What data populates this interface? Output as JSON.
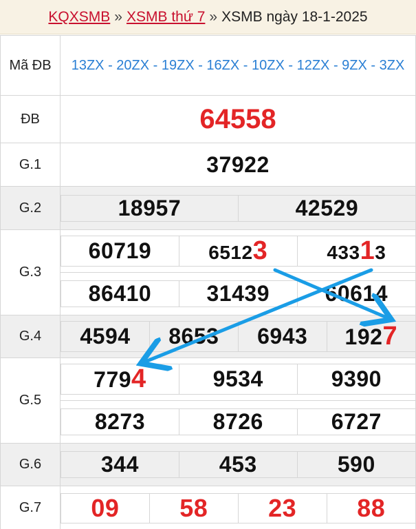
{
  "breadcrumb": {
    "home": "KQXSMB",
    "sep1": "»",
    "section": "XSMB thứ 7",
    "sep2": "»",
    "current": "XSMB ngày 18-1-2025"
  },
  "labels": {
    "ma_db": "Mã ĐB",
    "db": "ĐB",
    "g1": "G.1",
    "g2": "G.2",
    "g3": "G.3",
    "g4": "G.4",
    "g5": "G.5",
    "g6": "G.6",
    "g7": "G.7"
  },
  "codes": "13ZX - 20ZX - 19ZX - 16ZX - 10ZX - 12ZX - 9ZX - 3ZX",
  "db": "64558",
  "g1": "37922",
  "g2": [
    "18957",
    "42529"
  ],
  "g3": {
    "r1c1": "60719",
    "r1c2_prefix": "6512",
    "r1c2_highlight": "3",
    "r1c3_prefix": "433",
    "r1c3_highlight": "1",
    "r1c3_suffix": "3",
    "r2c1": "86410",
    "r2c2": "31439",
    "r2c3": "60614"
  },
  "g4": {
    "c1": "4594",
    "c2": "8653",
    "c3": "6943",
    "c4_prefix": "192",
    "c4_highlight": "7"
  },
  "g5": {
    "r1c1_prefix": "779",
    "r1c1_highlight": "4",
    "r1c2": "9534",
    "r1c3": "9390",
    "r2c1": "8273",
    "r2c2": "8726",
    "r2c3": "6727"
  },
  "g6": [
    "344",
    "453",
    "590"
  ],
  "g7": [
    "09",
    "58",
    "23",
    "88"
  ],
  "colors": {
    "accent_red": "#e32526",
    "link_red": "#c8102e",
    "code_blue": "#2a7fd4",
    "arrow_blue": "#1a9de6"
  }
}
